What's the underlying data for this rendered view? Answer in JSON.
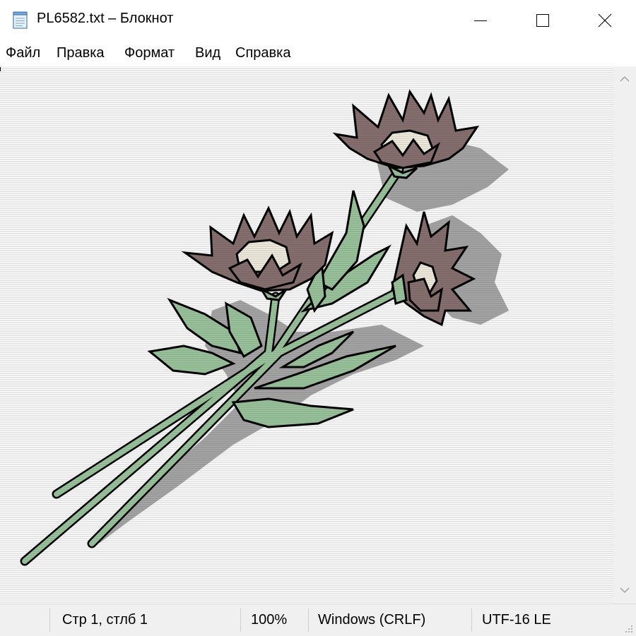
{
  "window": {
    "title": "PL6582.txt – Блокнот",
    "icon": "notepad-icon"
  },
  "controls": {
    "minimize_icon": "minimize-icon",
    "maximize_icon": "maximize-icon",
    "close_icon": "close-icon"
  },
  "menu": {
    "items": [
      {
        "label": "Файл"
      },
      {
        "label": "Правка"
      },
      {
        "label": "Формат"
      },
      {
        "label": "Вид"
      },
      {
        "label": "Справка"
      }
    ]
  },
  "editor": {
    "content_description_icon": "ascii-art-flowers",
    "colors": {
      "petals": "#8a7272",
      "leaves": "#9dc79f",
      "centers": "#f4efe2",
      "shadow": "#9a9a9a",
      "outline": "#000000"
    }
  },
  "statusbar": {
    "position": "Стр 1, стлб 1",
    "zoom": "100%",
    "line_endings": "Windows (CRLF)",
    "encoding": "UTF-16 LE"
  }
}
